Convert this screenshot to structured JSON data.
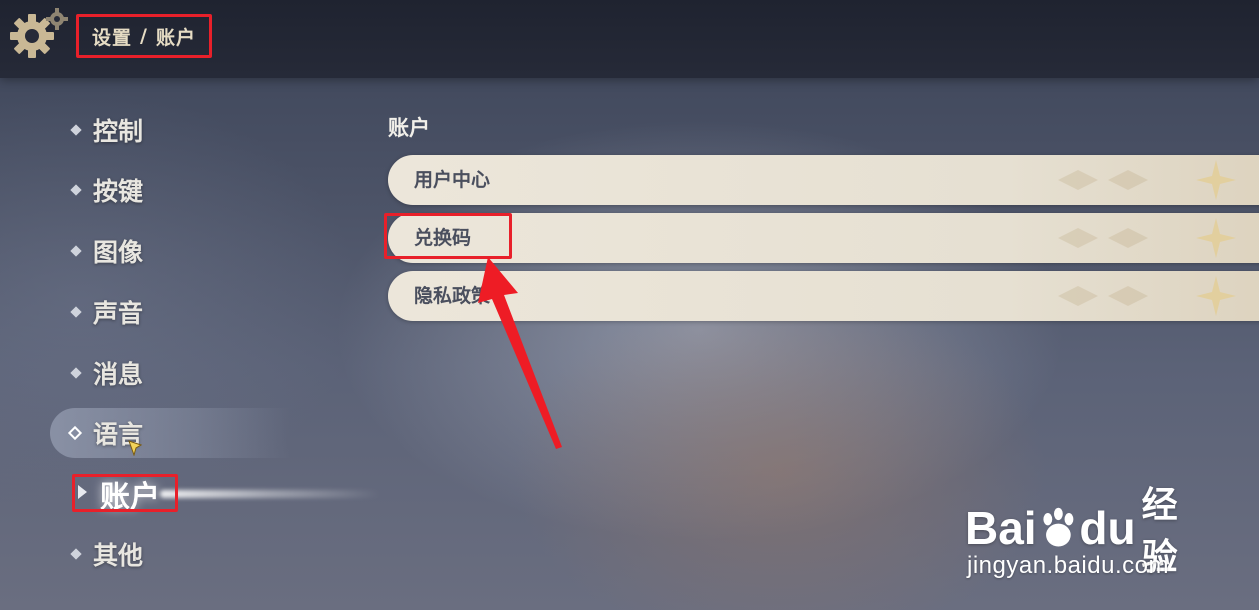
{
  "header": {
    "breadcrumb_parent": "设置",
    "breadcrumb_separator": "/",
    "breadcrumb_current": "账户"
  },
  "sidebar": {
    "items": [
      {
        "label": "控制"
      },
      {
        "label": "按键"
      },
      {
        "label": "图像"
      },
      {
        "label": "声音"
      },
      {
        "label": "消息"
      },
      {
        "label": "语言"
      },
      {
        "label": "账户"
      },
      {
        "label": "其他"
      }
    ],
    "active_index": 6,
    "hover_index": 5
  },
  "main": {
    "section_title": "账户",
    "options": [
      {
        "label": "用户中心"
      },
      {
        "label": "兑换码"
      },
      {
        "label": "隐私政策"
      }
    ]
  },
  "annotations": {
    "highlight_color": "#e8202a",
    "highlighted": [
      "breadcrumb",
      "兑换码",
      "账户"
    ]
  },
  "watermark": {
    "brand_left": "Bai",
    "brand_right": "du",
    "brand_cn": "经验",
    "url": "jingyan.baidu.com"
  },
  "colors": {
    "topbar": "#1f2330",
    "breadcrumb_text": "#e6dcc4",
    "option_bg": "#ece6da",
    "option_text": "#4a4f5e"
  }
}
